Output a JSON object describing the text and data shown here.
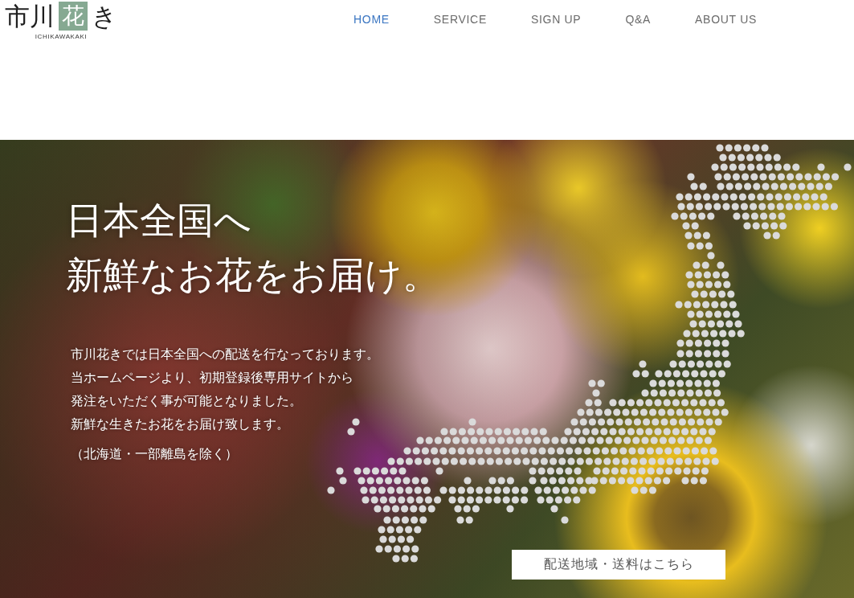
{
  "header": {
    "logo": {
      "text_before": "市川",
      "mark": "花",
      "text_after": "き",
      "romanized": "ICHIKAWAKAKI"
    },
    "nav": [
      {
        "label": "HOME",
        "selected": true
      },
      {
        "label": "SERVICE",
        "selected": false
      },
      {
        "label": "SIGN UP",
        "selected": false
      },
      {
        "label": "Q&A",
        "selected": false
      },
      {
        "label": "ABOUT US",
        "selected": false
      }
    ]
  },
  "hero": {
    "headline": [
      "日本全国へ",
      "新鮮なお花をお届け。"
    ],
    "paragraph": [
      "市川花きでは日本全国への配送を行なっております。",
      "当ホームページより、初期登録後専用サイトから",
      "発注をいただく事が可能となりました。",
      "新鮮な生きたお花をお届け致します。"
    ],
    "note": "（北海道・一部離島を除く）",
    "button": "配送地域・送料はこちら"
  }
}
